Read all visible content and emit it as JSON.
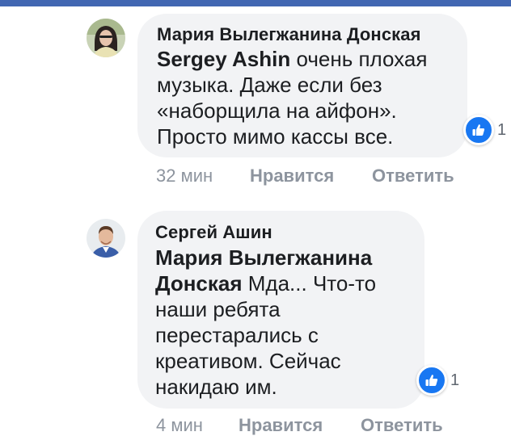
{
  "comments": [
    {
      "author": "Мария Вылегжанина Донская",
      "mention": "Sergey Ashin",
      "lines": [
        " очень плохая",
        "музыка. Даже если без",
        "«наборщила на айфон».",
        "Просто мимо кассы все."
      ],
      "reaction_count": "1",
      "time": "32 мин",
      "like_label": "Нравится",
      "reply_label": "Ответить"
    },
    {
      "author": "Сергей Ашин",
      "mention_line1": "Мария Вылегжанина",
      "mention_line2": "Донская",
      "lines": [
        " Мда... Что-то",
        "наши ребята",
        "перестарались с",
        "креативом. Сейчас",
        "накидаю им."
      ],
      "reaction_count": "1",
      "time": "4 мин",
      "like_label": "Нравится",
      "reply_label": "Ответить"
    }
  ],
  "colors": {
    "bubble": "#f2f3f5",
    "text": "#1c1e21",
    "meta": "#8d949e",
    "like": "#1877f2",
    "topbar": "#4267b2"
  },
  "icons": {
    "reaction": "thumbs-up-icon"
  }
}
